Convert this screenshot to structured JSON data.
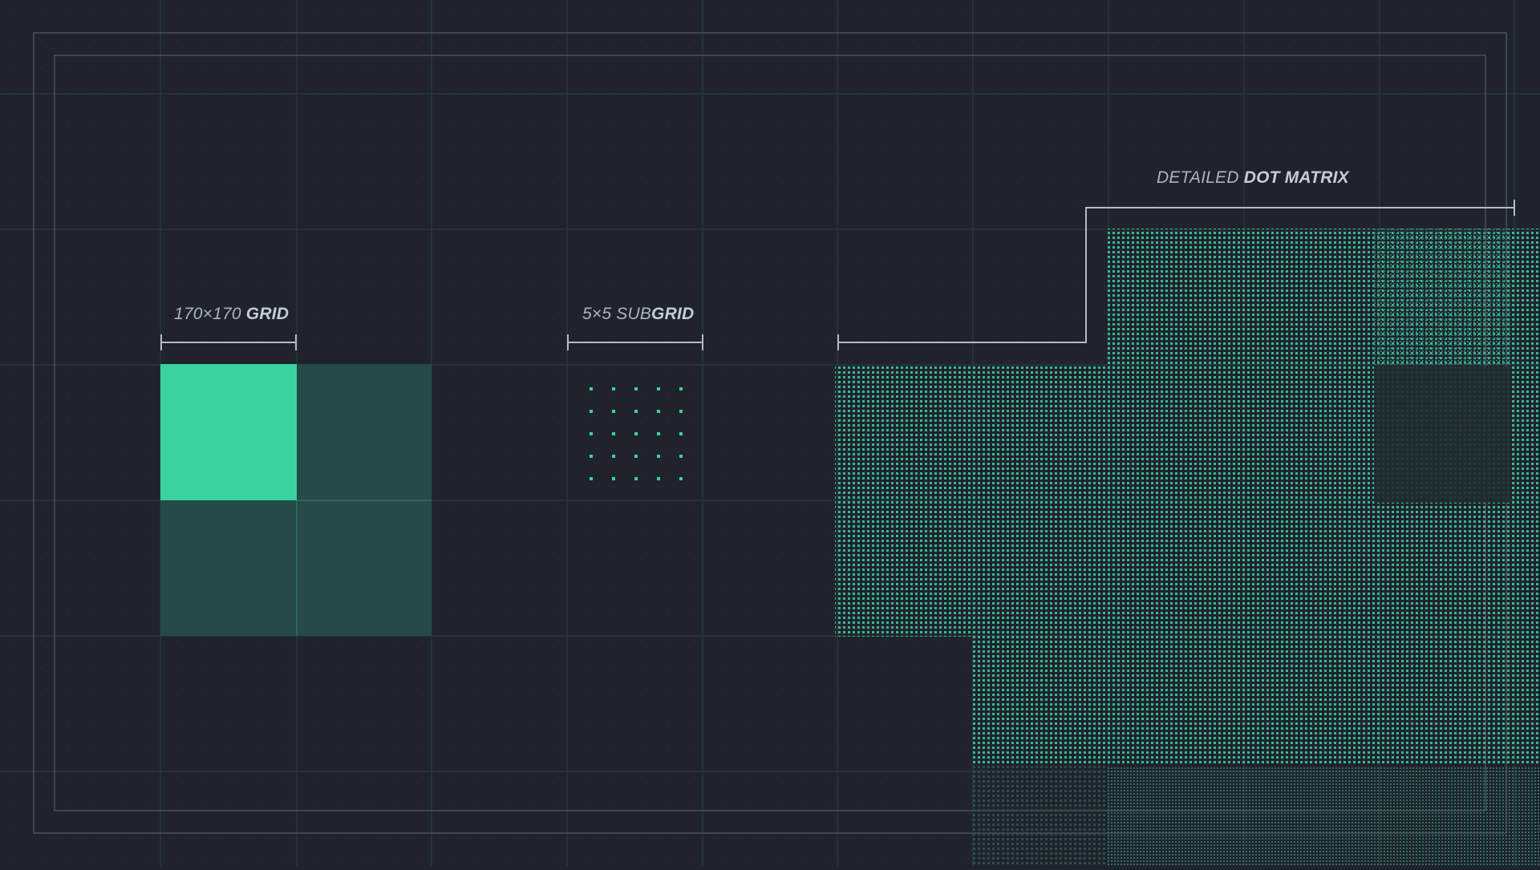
{
  "labels": {
    "grid": {
      "prefix": "170×170",
      "bold": "GRID"
    },
    "subgrid": {
      "prefix": "5×5 SUB",
      "bold": "GRID"
    },
    "matrix": {
      "prefix": "DETAILED",
      "bold": "DOT MATRIX"
    }
  },
  "colors": {
    "background": "#20232b",
    "grid_line": "#233036",
    "accent": "#3ad29f",
    "accent_dim": "#254a47",
    "frame": "#4a4f58",
    "dot": "#37b894",
    "bracket": "#b5bac1"
  },
  "grid_tiles": [
    {
      "name": "tile-bright",
      "state": "filled-bright"
    },
    {
      "name": "tile-dim",
      "state": "filled-dim"
    },
    {
      "name": "tile-dim",
      "state": "filled-dim"
    },
    {
      "name": "tile-dim",
      "state": "filled-dim"
    }
  ],
  "subgrid": {
    "rows": 5,
    "cols": 5
  }
}
